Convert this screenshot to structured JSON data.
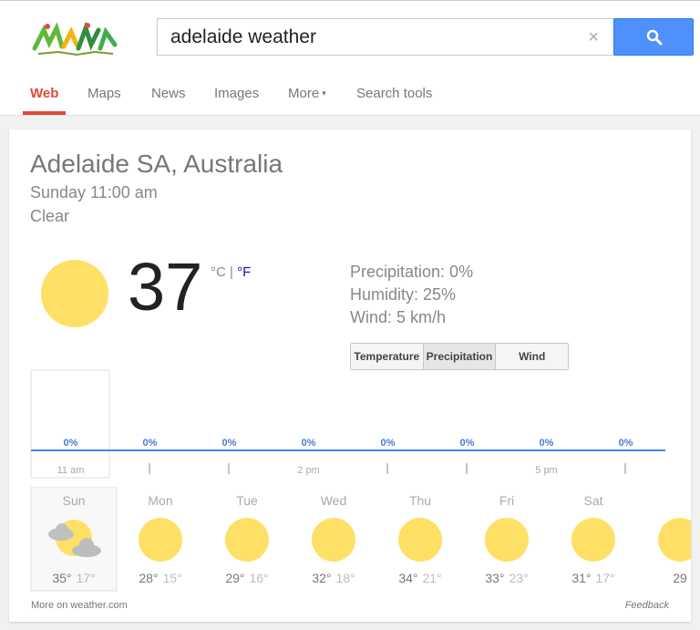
{
  "search": {
    "query": "adelaide weather",
    "clear_symbol": "×"
  },
  "nav": {
    "tabs": [
      {
        "label": "Web"
      },
      {
        "label": "Maps"
      },
      {
        "label": "News"
      },
      {
        "label": "Images"
      },
      {
        "label": "More"
      },
      {
        "label": "Search tools"
      }
    ],
    "more_caret": "▾"
  },
  "weather": {
    "location": "Adelaide SA, Australia",
    "time": "Sunday 11:00 am",
    "condition": "Clear",
    "temp": "37",
    "unit_c": "°C",
    "unit_sep": " | ",
    "unit_f": "°F",
    "precipitation": "Precipitation: 0%",
    "humidity": "Humidity: 25%",
    "wind": "Wind: 5 km/h",
    "metric_tabs": [
      "Temperature",
      "Precipitation",
      "Wind"
    ],
    "selected_metric": "Precipitation",
    "more_link": "More on weather.com",
    "feedback": "Feedback"
  },
  "chart_data": {
    "type": "line",
    "title": "",
    "series": [
      {
        "values": [
          0,
          0,
          0,
          0,
          0,
          0,
          0,
          0
        ]
      }
    ],
    "value_labels": [
      "0%",
      "0%",
      "0%",
      "0%",
      "0%",
      "0%",
      "0%",
      "0%"
    ],
    "x_labels": [
      "11 am",
      "",
      "",
      "2 pm",
      "",
      "",
      "5 pm",
      ""
    ],
    "ylim": [
      0,
      100
    ],
    "highlighted_index": 0
  },
  "forecast": [
    {
      "day": "Sun",
      "icon": "partly-cloudy-icon",
      "hi": "35°",
      "lo": "17°"
    },
    {
      "day": "Mon",
      "icon": "sun-icon",
      "hi": "28°",
      "lo": "15°"
    },
    {
      "day": "Tue",
      "icon": "sun-icon",
      "hi": "29°",
      "lo": "16°"
    },
    {
      "day": "Wed",
      "icon": "sun-icon",
      "hi": "32°",
      "lo": "18°"
    },
    {
      "day": "Thu",
      "icon": "sun-icon",
      "hi": "34°",
      "lo": "21°"
    },
    {
      "day": "Fri",
      "icon": "sun-icon",
      "hi": "33°",
      "lo": "23°"
    },
    {
      "day": "Sat",
      "icon": "sun-icon",
      "hi": "31°",
      "lo": "17°"
    },
    {
      "day": "",
      "icon": "sun-icon",
      "hi": "29",
      "lo": ""
    }
  ],
  "colors": {
    "sun": "#ffe066",
    "accent": "#dd4b39",
    "line": "#4285f4",
    "link": "#1a0dab"
  }
}
